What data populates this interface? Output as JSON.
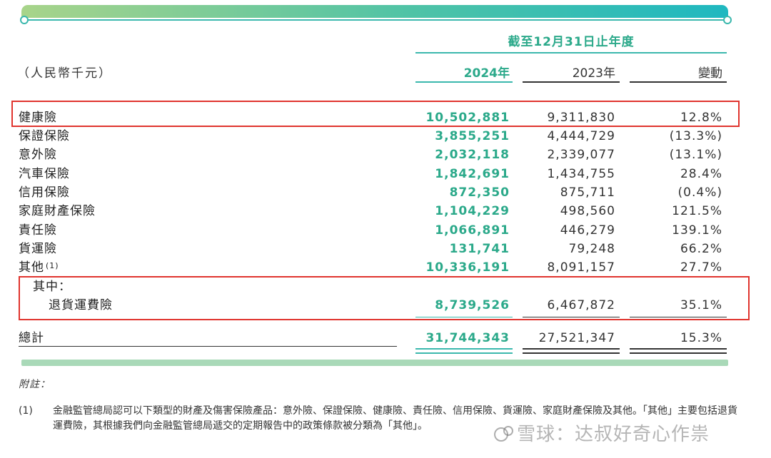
{
  "header": {
    "period": "截至12月31日止年度",
    "unit": "（人民幣千元）",
    "col_2024": "2024年",
    "col_2023": "2023年",
    "col_change": "變動"
  },
  "rows": [
    {
      "label": "健康險",
      "v2024": "10,502,881",
      "v2023": "9,311,830",
      "change": "12.8%"
    },
    {
      "label": "保證保險",
      "v2024": "3,855,251",
      "v2023": "4,444,729",
      "change": "(13.3%)"
    },
    {
      "label": "意外險",
      "v2024": "2,032,118",
      "v2023": "2,339,077",
      "change": "(13.1%)"
    },
    {
      "label": "汽車保險",
      "v2024": "1,842,691",
      "v2023": "1,434,755",
      "change": "28.4%"
    },
    {
      "label": "信用保險",
      "v2024": "872,350",
      "v2023": "875,711",
      "change": "(0.4%)"
    },
    {
      "label": "家庭財產保險",
      "v2024": "1,104,229",
      "v2023": "498,560",
      "change": "121.5%"
    },
    {
      "label": "責任險",
      "v2024": "1,066,891",
      "v2023": "446,279",
      "change": "139.1%"
    },
    {
      "label": "貨運險",
      "v2024": "131,741",
      "v2023": "79,248",
      "change": "66.2%"
    },
    {
      "label": "其他",
      "note_ref": "(1)",
      "v2024": "10,336,191",
      "v2023": "8,091,157",
      "change": "27.7%"
    }
  ],
  "of_which": {
    "label": "其中：",
    "sub_label": "退貨運費險",
    "v2024": "8,739,526",
    "v2023": "6,467,872",
    "change": "35.1%"
  },
  "total": {
    "label": "總計",
    "v2024": "31,744,343",
    "v2023": "27,521,347",
    "change": "15.3%"
  },
  "notes": {
    "title": "附註：",
    "items": [
      {
        "num": "(1)",
        "text": "金融監管總局認可以下類型的財產及傷害保險產品：意外險、保證保險、健康險、責任險、信用保險、貨運險、家庭財產保險及其他。「其他」主要包括退貨運費險，其根據我們向金融監管總局遞交的定期報告中的政策條款被分類為「其他」。"
      }
    ]
  },
  "watermark": {
    "icon": "snowball-icon",
    "text": "雪球：达叔好奇心作祟"
  },
  "colors": {
    "accent": "#2ba98a",
    "highlight_box": "#e0342e"
  }
}
